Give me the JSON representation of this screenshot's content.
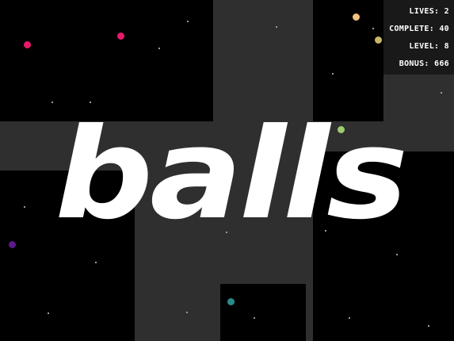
{
  "title": "balls",
  "hud": {
    "lives": "LIVES: 2",
    "complete": "COMPLETE: 40",
    "level": "LEVEL: 8",
    "bonus": "BONUS: 666"
  },
  "colors": {
    "background": "#000000",
    "filled_area": "#2f2f2f",
    "hud_background": "#191919",
    "logo": "#ffffff",
    "ball_colors": [
      "#e8196a",
      "#e8196a",
      "#f2c27c",
      "#c9b766",
      "#9ccc6e",
      "#5a1a8a",
      "#2a8c8a"
    ]
  }
}
